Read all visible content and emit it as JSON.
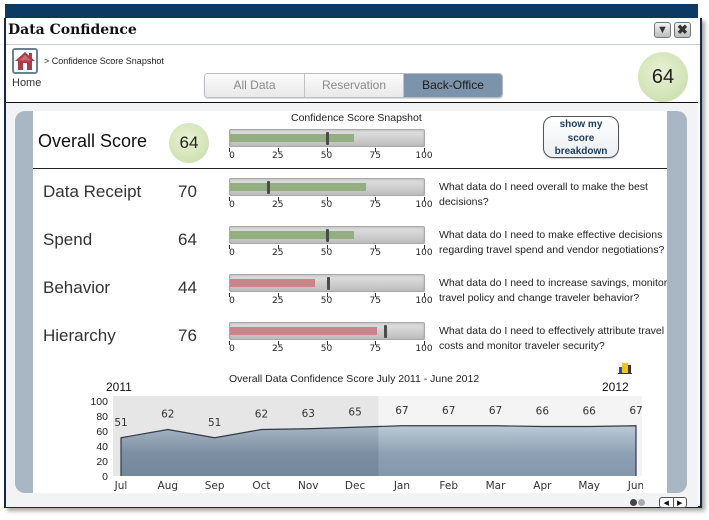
{
  "window": {
    "title": "Data Confidence",
    "minimize_icon": "chevron-down-icon",
    "close_icon": "close-icon"
  },
  "nav": {
    "home_label": "Home",
    "breadcrumb": "> Confidence Score Snapshot",
    "tabs": [
      {
        "label": "All Data",
        "active": false
      },
      {
        "label": "Reservation",
        "active": false
      },
      {
        "label": "Back-Office",
        "active": true
      }
    ],
    "header_score": "64"
  },
  "overall": {
    "label": "Overall Score",
    "score": "64",
    "snapshot_title": "Confidence Score Snapshot",
    "value": 64,
    "target": 50,
    "status": "good",
    "breakdown_button": [
      "show my",
      "score",
      "breakdown"
    ]
  },
  "axis_ticks": [
    "0",
    "25",
    "50",
    "75",
    "100"
  ],
  "categories": [
    {
      "label": "Data Receipt",
      "score": "70",
      "value": 70,
      "target": 20,
      "status": "good",
      "question": "What data do I need overall to make the best decisions?"
    },
    {
      "label": "Spend",
      "score": "64",
      "value": 64,
      "target": 50,
      "status": "good",
      "question": "What data do I need to make effective decisions regarding travel spend and vendor negotiations?"
    },
    {
      "label": "Behavior",
      "score": "44",
      "value": 44,
      "target": 51,
      "status": "bad",
      "question": "What data do I need to increase savings, monitor travel policy and change traveler behavior?"
    },
    {
      "label": "Hierarchy",
      "score": "76",
      "value": 76,
      "target": 80,
      "status": "bad",
      "question": "What data do I need to effectively attribute travel costs and monitor traveler security?"
    }
  ],
  "colors": {
    "good": "#93ae80",
    "bad": "#c9848a",
    "marker": "#4a4a4a",
    "accent": "#7b93ab",
    "topbar": "#0d3a63"
  },
  "chart_data": {
    "type": "area",
    "title": "Overall Data Confidence Score July 2011 - June 2012",
    "year_start_label": "2011",
    "year_end_label": "2012",
    "categories": [
      "Jul",
      "Aug",
      "Sep",
      "Oct",
      "Nov",
      "Dec",
      "Jan",
      "Feb",
      "Mar",
      "Apr",
      "May",
      "Jun"
    ],
    "values": [
      51,
      62,
      51,
      62,
      63,
      65,
      67,
      67,
      67,
      66,
      66,
      67
    ],
    "data_labels": [
      "51",
      "62",
      "51",
      "62",
      "63",
      "65",
      "67",
      "67",
      "67",
      "66",
      "66",
      "67"
    ],
    "yticks": [
      "0",
      "20",
      "40",
      "60",
      "80",
      "100"
    ],
    "ylim": [
      0,
      100
    ],
    "highlighted_range": [
      "Jul",
      "Dec"
    ],
    "xlabel": "",
    "ylabel": "",
    "grid": false,
    "legend": "none",
    "chart_icon": "bar-chart-icon"
  },
  "pager": {
    "pages": 2,
    "current": 1
  }
}
